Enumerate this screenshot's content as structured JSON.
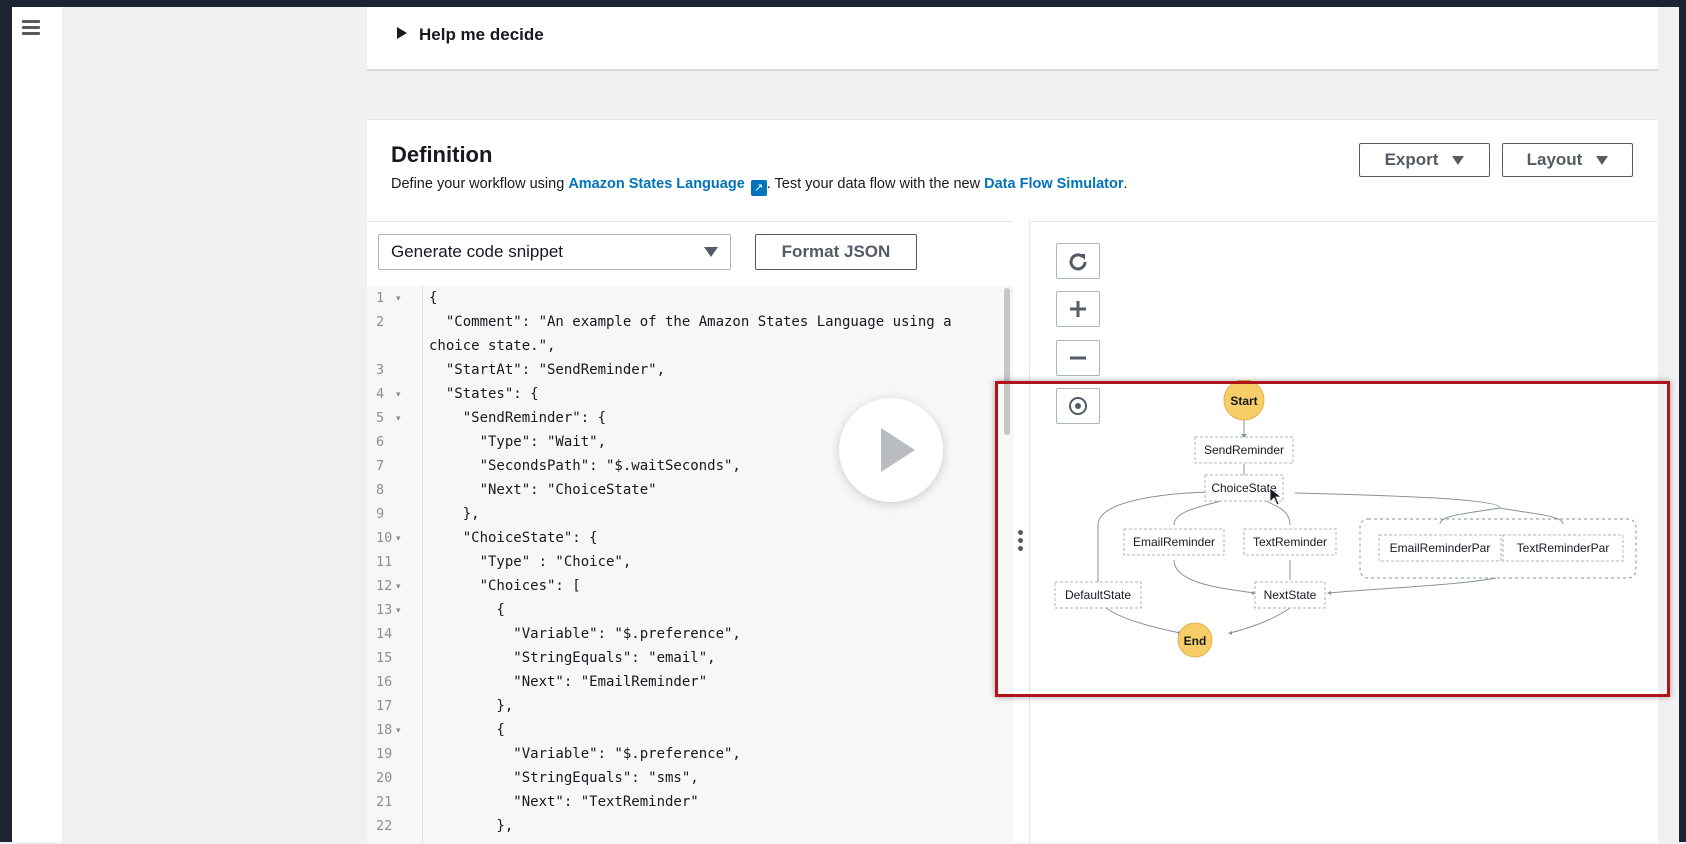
{
  "help": {
    "label": "Help me decide"
  },
  "definition": {
    "title": "Definition",
    "desc_prefix": "Define your workflow using ",
    "link_asl": "Amazon States Language",
    "desc_middle": ". Test your data flow with the new ",
    "link_simulator": "Data Flow Simulator",
    "desc_suffix": ".",
    "export_label": "Export",
    "layout_label": "Layout",
    "snippet_label": "Generate code snippet",
    "format_label": "Format JSON"
  },
  "code_lines": [
    {
      "n": "1",
      "fold": true,
      "t": "{"
    },
    {
      "n": "2",
      "fold": false,
      "t": "  \"Comment\": \"An example of the Amazon States Language using a"
    },
    {
      "n": "",
      "fold": false,
      "t": "choice state.\","
    },
    {
      "n": "3",
      "fold": false,
      "t": "  \"StartAt\": \"SendReminder\","
    },
    {
      "n": "4",
      "fold": true,
      "t": "  \"States\": {"
    },
    {
      "n": "5",
      "fold": true,
      "t": "    \"SendReminder\": {"
    },
    {
      "n": "6",
      "fold": false,
      "t": "      \"Type\": \"Wait\","
    },
    {
      "n": "7",
      "fold": false,
      "t": "      \"SecondsPath\": \"$.waitSeconds\","
    },
    {
      "n": "8",
      "fold": false,
      "t": "      \"Next\": \"ChoiceState\""
    },
    {
      "n": "9",
      "fold": false,
      "t": "    },"
    },
    {
      "n": "10",
      "fold": true,
      "t": "    \"ChoiceState\": {"
    },
    {
      "n": "11",
      "fold": false,
      "t": "      \"Type\" : \"Choice\","
    },
    {
      "n": "12",
      "fold": true,
      "t": "      \"Choices\": ["
    },
    {
      "n": "13",
      "fold": true,
      "t": "        {"
    },
    {
      "n": "14",
      "fold": false,
      "t": "          \"Variable\": \"$.preference\","
    },
    {
      "n": "15",
      "fold": false,
      "t": "          \"StringEquals\": \"email\","
    },
    {
      "n": "16",
      "fold": false,
      "t": "          \"Next\": \"EmailReminder\""
    },
    {
      "n": "17",
      "fold": false,
      "t": "        },"
    },
    {
      "n": "18",
      "fold": true,
      "t": "        {"
    },
    {
      "n": "19",
      "fold": false,
      "t": "          \"Variable\": \"$.preference\","
    },
    {
      "n": "20",
      "fold": false,
      "t": "          \"StringEquals\": \"sms\","
    },
    {
      "n": "21",
      "fold": false,
      "t": "          \"Next\": \"TextReminder\""
    },
    {
      "n": "22",
      "fold": false,
      "t": "        },"
    }
  ],
  "graph": {
    "start": "Start",
    "end": "End",
    "nodes": {
      "send": "SendReminder",
      "choice": "ChoiceState",
      "email": "EmailReminder",
      "text": "TextReminder",
      "email_par": "EmailReminderPar",
      "text_par": "TextReminderPar",
      "default": "DefaultState",
      "next": "NextState"
    }
  },
  "icons": {
    "menu": "menu-icon",
    "refresh": "refresh-icon",
    "zoom_in": "plus-icon",
    "zoom_out": "minus-icon",
    "center": "target-icon",
    "play": "play-icon",
    "external": "external-link-icon"
  },
  "colors": {
    "link": "#0073bb",
    "start_end_node": "#f7cd68",
    "highlight": "#b0141a"
  }
}
